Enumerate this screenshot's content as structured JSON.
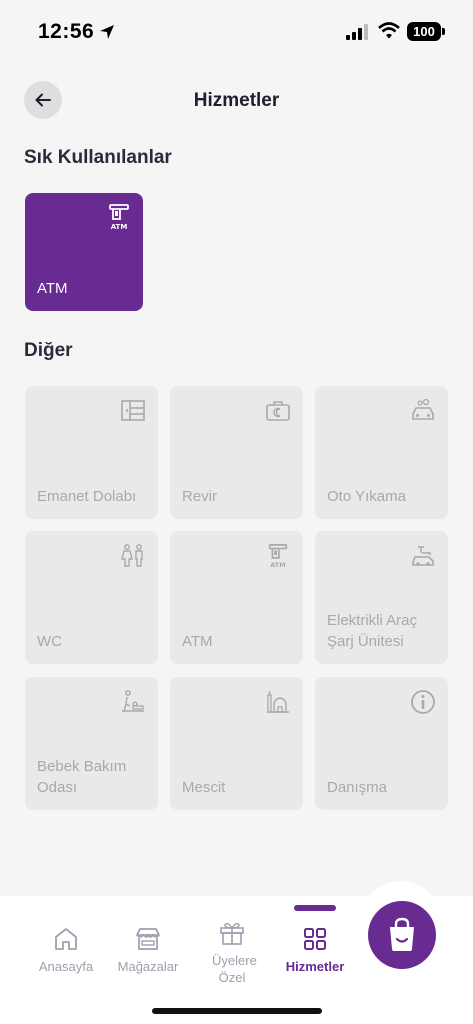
{
  "status_bar": {
    "time": "12:56",
    "battery": "100"
  },
  "header": {
    "title": "Hizmetler",
    "back_icon": "arrow-left-icon"
  },
  "favorites": {
    "title": "Sık Kullanılanlar",
    "items": [
      {
        "label": "ATM",
        "icon": "atm-icon"
      }
    ]
  },
  "others": {
    "title": "Diğer",
    "items": [
      {
        "label": "Emanet Dolabı",
        "icon": "locker-icon"
      },
      {
        "label": "Revir",
        "icon": "medical-bag-icon"
      },
      {
        "label": "Oto Yıkama",
        "icon": "car-wash-icon"
      },
      {
        "label": "WC",
        "icon": "wc-icon"
      },
      {
        "label": "ATM",
        "icon": "atm-icon"
      },
      {
        "label": "Elektrikli Araç Şarj Ünitesi",
        "icon": "ev-charging-icon"
      },
      {
        "label": "Bebek Bakım Odası",
        "icon": "baby-care-icon"
      },
      {
        "label": "Mescit",
        "icon": "mosque-icon"
      },
      {
        "label": "Danışma",
        "icon": "info-icon"
      }
    ]
  },
  "bottom_nav": {
    "items": [
      {
        "label": "Anasayfa",
        "icon": "home-icon"
      },
      {
        "label": "Mağazalar",
        "icon": "store-icon"
      },
      {
        "label": "Üyelere Özel",
        "icon": "gift-icon"
      },
      {
        "label": "Hizmetler",
        "icon": "grid-icon",
        "active": true
      }
    ],
    "fab_icon": "shopping-bag-icon"
  },
  "colors": {
    "accent": "#672b91",
    "tile_bg": "#e9e9e9",
    "page_bg": "#f5f5f5"
  }
}
